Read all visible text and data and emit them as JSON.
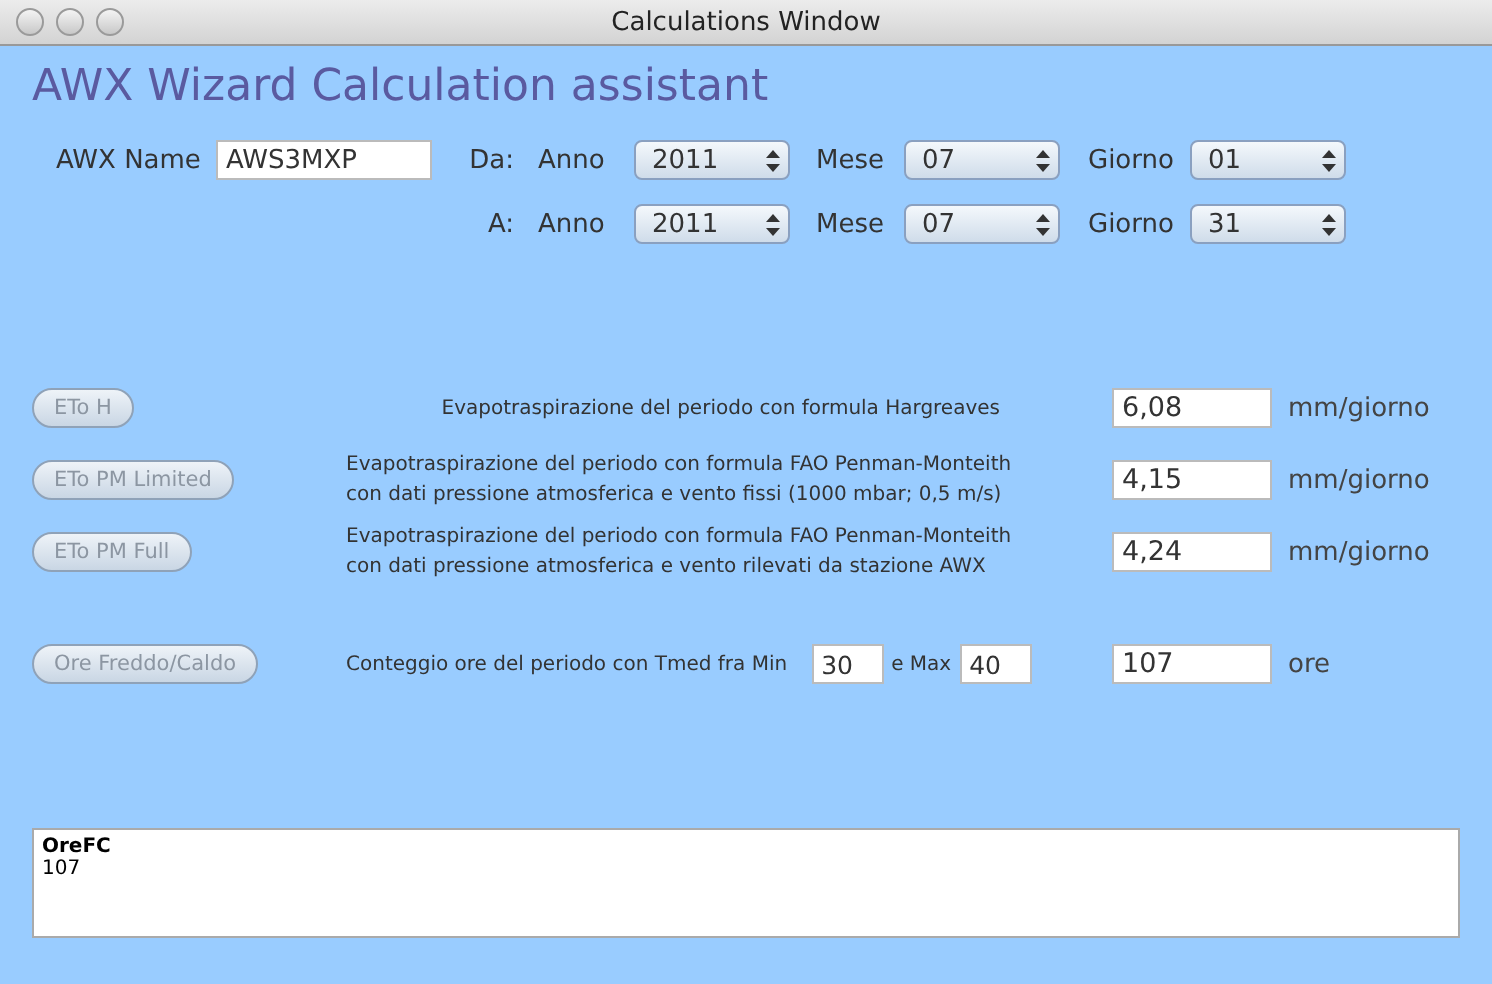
{
  "window": {
    "title": "Calculations Window"
  },
  "heading": "AWX Wizard Calculation assistant",
  "awx_name": {
    "label": "AWX Name",
    "value": "AWS3MXP"
  },
  "date_rows": [
    {
      "label": "Da:",
      "fields": [
        {
          "label": "Anno",
          "value": "2011"
        },
        {
          "label": "Mese",
          "value": "07"
        },
        {
          "label": "Giorno",
          "value": "01"
        }
      ]
    },
    {
      "label": "A:",
      "fields": [
        {
          "label": "Anno",
          "value": "2011"
        },
        {
          "label": "Mese",
          "value": "07"
        },
        {
          "label": "Giorno",
          "value": "31"
        }
      ]
    }
  ],
  "calculations": [
    {
      "kind": "formula",
      "button": "ETo H",
      "disabled": true,
      "lines": [
        "Evapotraspirazione del periodo con formula Hargreaves"
      ],
      "result": "6,08",
      "unit": "mm/giorno"
    },
    {
      "kind": "formula",
      "button": "ETo PM Limited",
      "disabled": true,
      "lines": [
        "Evapotraspirazione del periodo con formula FAO Penman-Monteith",
        "con dati pressione atmosferica e vento fissi (1000 mbar; 0,5 m/s)"
      ],
      "result": "4,15",
      "unit": "mm/giorno"
    },
    {
      "kind": "formula",
      "button": "ETo PM Full",
      "disabled": true,
      "lines": [
        "Evapotraspirazione del periodo con formula FAO Penman-Monteith",
        "con dati pressione atmosferica e vento rilevati da stazione AWX"
      ],
      "result": "4,24",
      "unit": "mm/giorno"
    },
    {
      "kind": "count",
      "button": "Ore Freddo/Caldo",
      "disabled": true,
      "label": "Conteggio ore del periodo con Tmed fra Min",
      "min": "30",
      "max_label": "e Max",
      "max": "40",
      "result": "107",
      "unit": "ore"
    }
  ],
  "output": {
    "title": "OreFC",
    "value": "107"
  }
}
